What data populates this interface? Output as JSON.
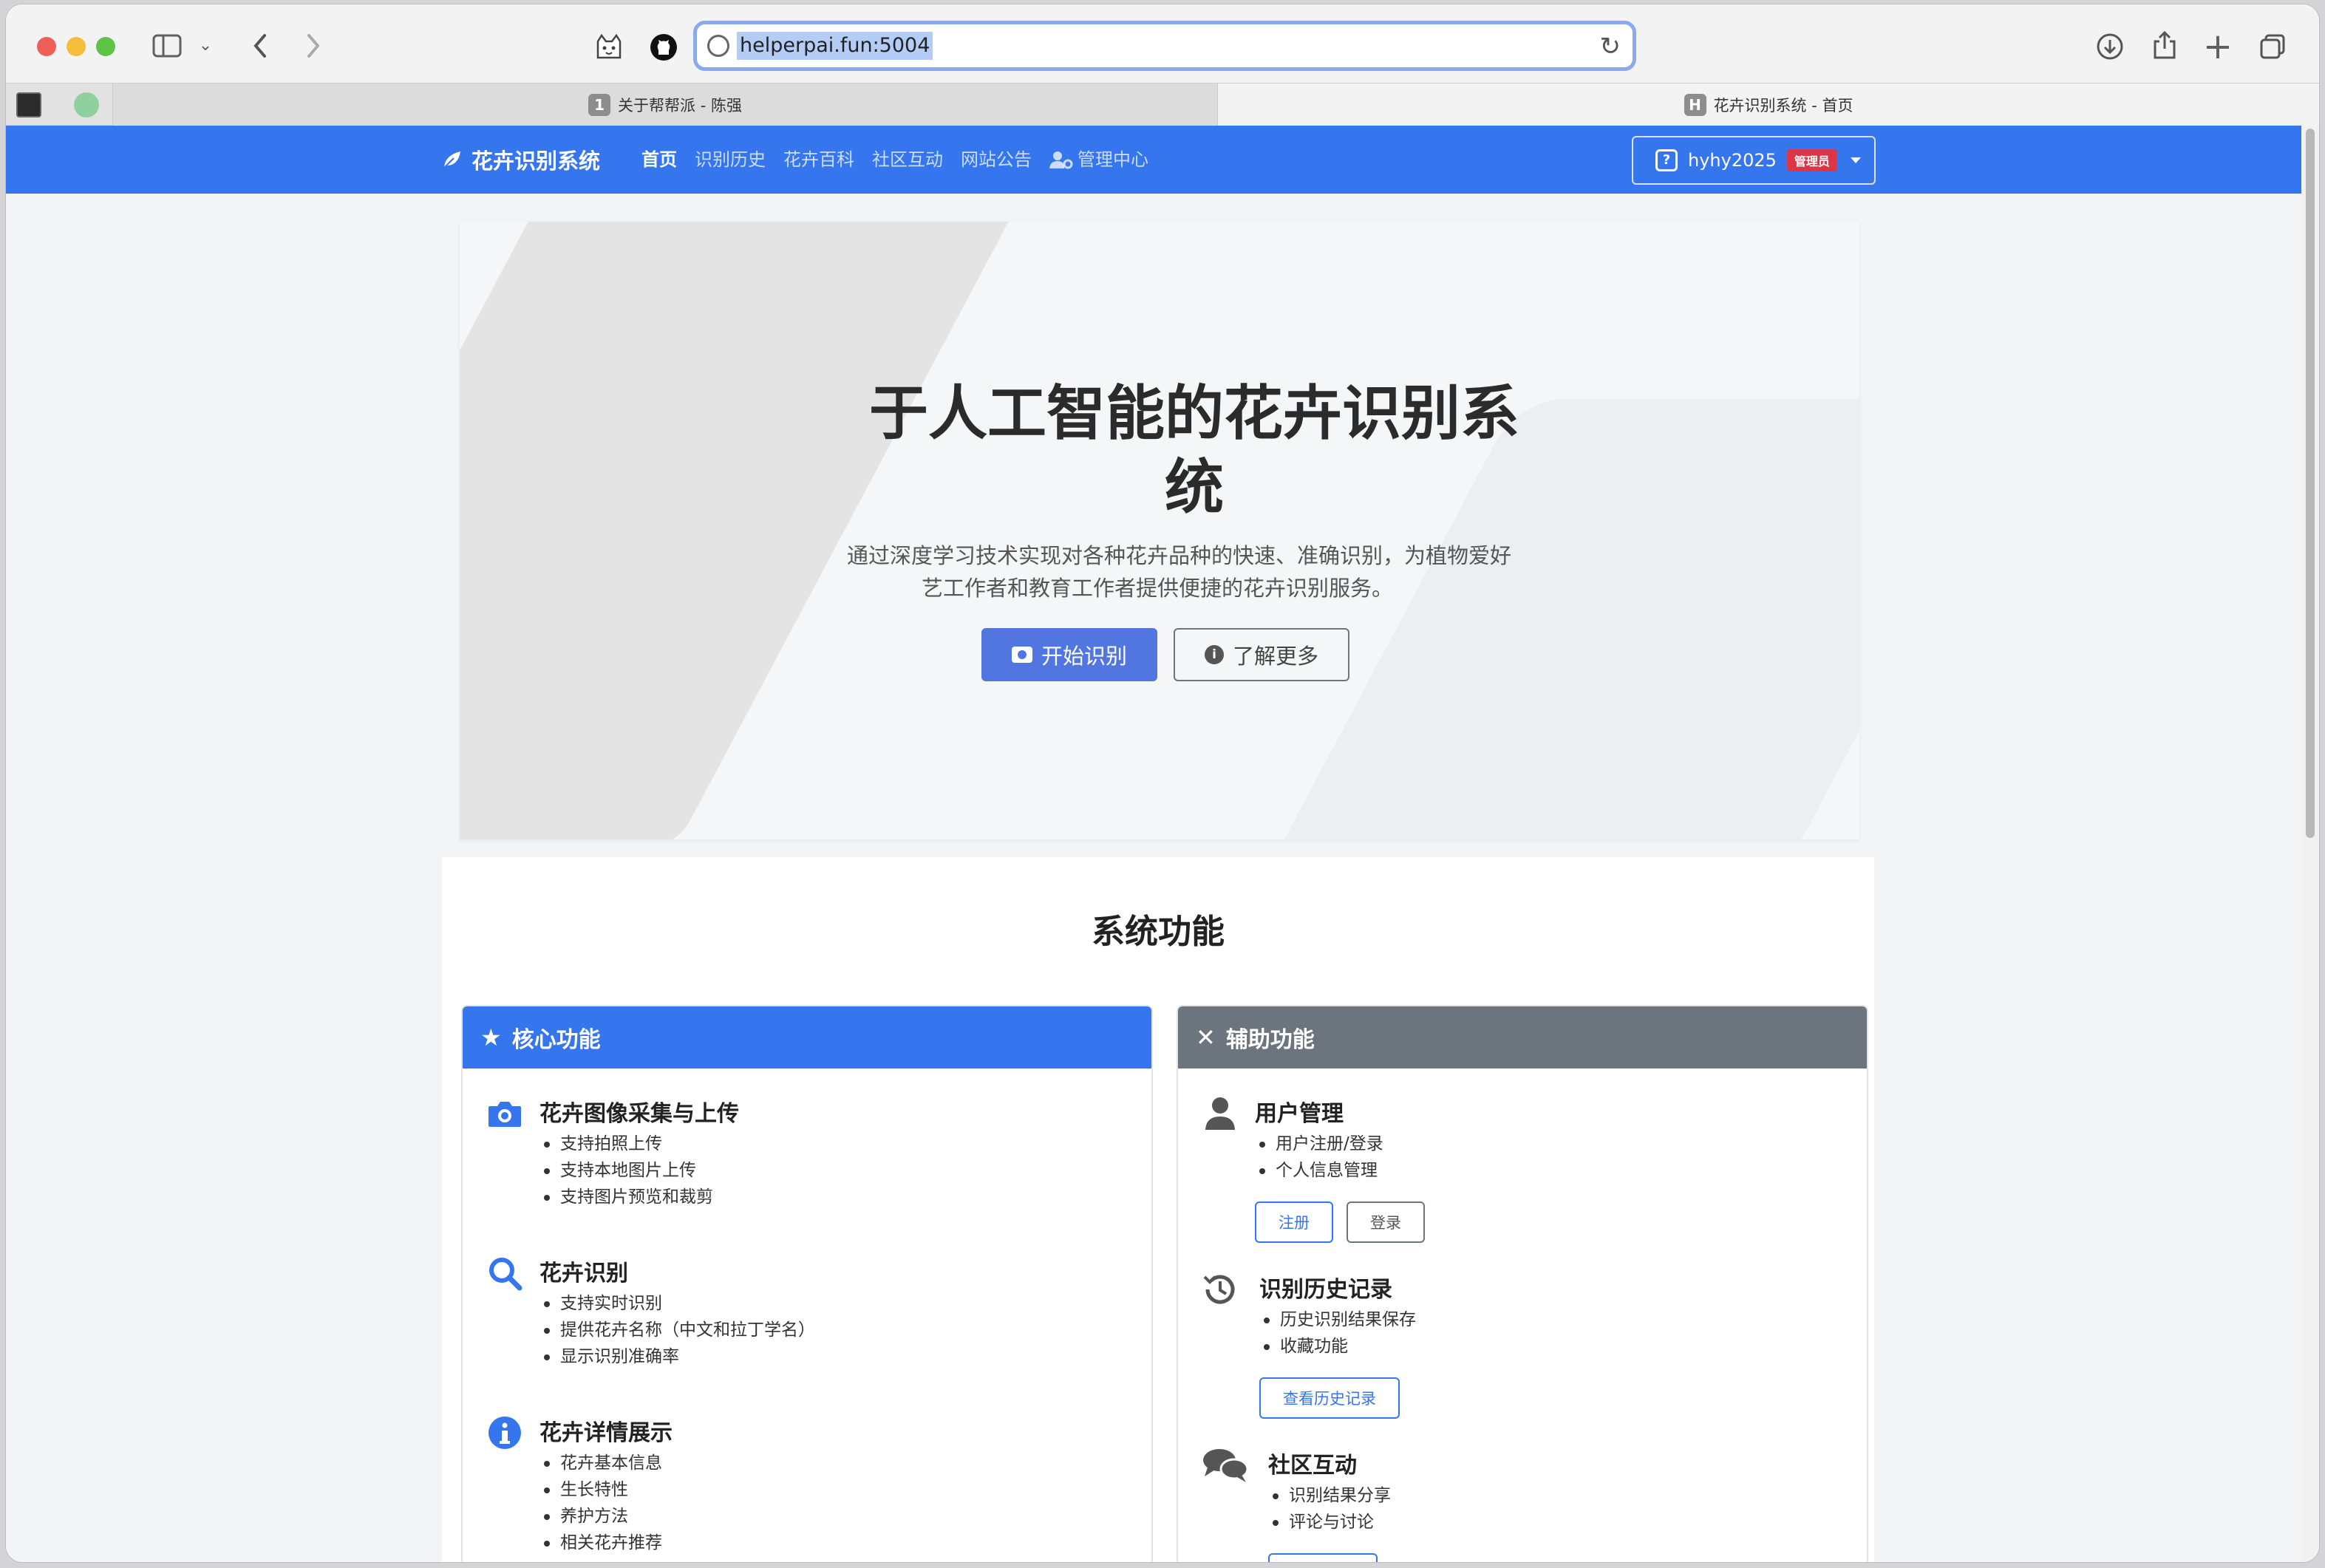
{
  "browser": {
    "url": "helperpai.fun:5004",
    "tabs": [
      {
        "badge": "1",
        "title": "关于帮帮派 - 陈强"
      },
      {
        "badge": "H",
        "title": "花卉识别系统 - 首页"
      }
    ]
  },
  "navbar": {
    "brand": "花卉识别系统",
    "items": [
      "首页",
      "识别历史",
      "花卉百科",
      "社区互动",
      "网站公告",
      "管理中心"
    ],
    "user": {
      "name": "hyhy2025",
      "role": "管理员",
      "icon": "?"
    }
  },
  "hero": {
    "title_line1": "于人工智能的花卉识别系",
    "title_line2": "统",
    "desc_line1": "通过深度学习技术实现对各种花卉品种的快速、准确识别，为植物爱好",
    "desc_line2": "艺工作者和教育工作者提供便捷的花卉识别服务。",
    "primary_button": "开始识别",
    "secondary_button": "了解更多"
  },
  "features": {
    "title": "系统功能",
    "core": {
      "header": "核心功能",
      "color": "#3575ee",
      "items": [
        {
          "title": "花卉图像采集与上传",
          "icon": "camera-icon",
          "points": [
            "支持拍照上传",
            "支持本地图片上传",
            "支持图片预览和裁剪"
          ]
        },
        {
          "title": "花卉识别",
          "icon": "search-icon",
          "points": [
            "支持实时识别",
            "提供花卉名称（中文和拉丁学名）",
            "显示识别准确率"
          ]
        },
        {
          "title": "花卉详情展示",
          "icon": "info-icon",
          "points": [
            "花卉基本信息",
            "生长特性",
            "养护方法",
            "相关花卉推荐"
          ]
        }
      ]
    },
    "aux": {
      "header": "辅助功能",
      "color": "#6c757d",
      "items": [
        {
          "title": "用户管理",
          "icon": "user-icon",
          "points": [
            "用户注册/登录",
            "个人信息管理"
          ],
          "buttons": [
            "注册",
            "登录"
          ]
        },
        {
          "title": "识别历史记录",
          "icon": "history-icon",
          "points": [
            "历史识别结果保存",
            "收藏功能"
          ],
          "buttons": [
            "查看历史记录"
          ]
        },
        {
          "title": "社区互动",
          "icon": "comments-icon",
          "points": [
            "识别结果分享",
            "评论与讨论"
          ]
        }
      ]
    }
  }
}
